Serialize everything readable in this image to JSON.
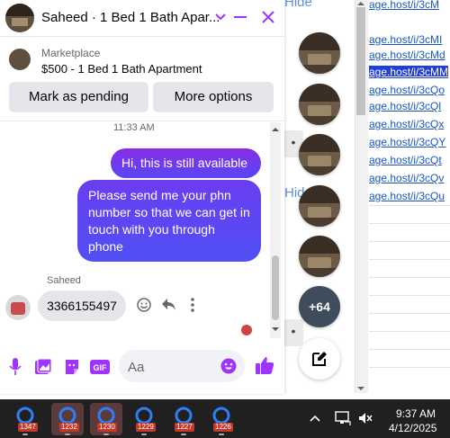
{
  "background_page": {
    "links": [
      "age.host/i/3cM",
      "age.host/i/3cMI",
      "age.host/i/3cMd",
      "age.host/i/3cMM",
      "age.host/i/3cQo",
      "age.host/i/3cQl",
      "age.host/i/3cQx",
      "age.host/i/3cQY",
      "age.host/i/3cQt",
      "age.host/i/3cQv",
      "age.host/i/3cQu"
    ],
    "hide_labels": [
      "Hide",
      "Hid"
    ],
    "more_dots": [
      "•",
      "•"
    ]
  },
  "chat_heads": {
    "more_count": "+64"
  },
  "chat": {
    "title": "Saheed · 1 Bed 1 Bath Apar...",
    "marketplace_label": "Marketplace",
    "listing_title": "$500 - 1 Bed 1 Bath Apartment",
    "mark_pending_label": "Mark as pending",
    "more_options_label": "More options",
    "timestamp": "11:33 AM",
    "messages_out": [
      "Hi, this is still available",
      "Please send me your phn number so that we can get in touch with you through phone"
    ],
    "sender_name": "Saheed",
    "message_in": "3366155497",
    "input_placeholder": "Aa"
  },
  "taskbar": {
    "badges": [
      "1347",
      "1232",
      "1230",
      "1229",
      "1227",
      "1226"
    ],
    "time": "9:37 AM",
    "date": "4/12/2025"
  },
  "colors": {
    "accent": "#a033ff",
    "bubble_out": "#6b3df0",
    "icon_blue": "#0084ff"
  }
}
